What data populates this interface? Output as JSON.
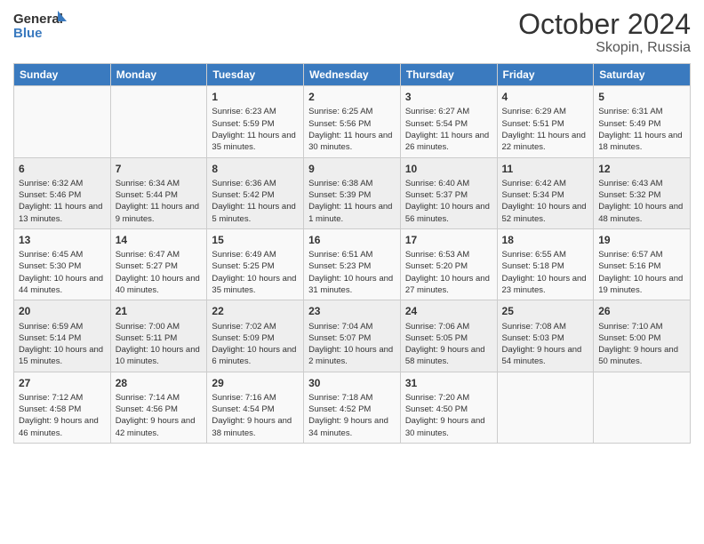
{
  "header": {
    "logo_line1": "General",
    "logo_line2": "Blue",
    "title": "October 2024",
    "subtitle": "Skopin, Russia"
  },
  "days_of_week": [
    "Sunday",
    "Monday",
    "Tuesday",
    "Wednesday",
    "Thursday",
    "Friday",
    "Saturday"
  ],
  "weeks": [
    [
      {
        "day": "",
        "info": ""
      },
      {
        "day": "",
        "info": ""
      },
      {
        "day": "1",
        "info": "Sunrise: 6:23 AM\nSunset: 5:59 PM\nDaylight: 11 hours and 35 minutes."
      },
      {
        "day": "2",
        "info": "Sunrise: 6:25 AM\nSunset: 5:56 PM\nDaylight: 11 hours and 30 minutes."
      },
      {
        "day": "3",
        "info": "Sunrise: 6:27 AM\nSunset: 5:54 PM\nDaylight: 11 hours and 26 minutes."
      },
      {
        "day": "4",
        "info": "Sunrise: 6:29 AM\nSunset: 5:51 PM\nDaylight: 11 hours and 22 minutes."
      },
      {
        "day": "5",
        "info": "Sunrise: 6:31 AM\nSunset: 5:49 PM\nDaylight: 11 hours and 18 minutes."
      }
    ],
    [
      {
        "day": "6",
        "info": "Sunrise: 6:32 AM\nSunset: 5:46 PM\nDaylight: 11 hours and 13 minutes."
      },
      {
        "day": "7",
        "info": "Sunrise: 6:34 AM\nSunset: 5:44 PM\nDaylight: 11 hours and 9 minutes."
      },
      {
        "day": "8",
        "info": "Sunrise: 6:36 AM\nSunset: 5:42 PM\nDaylight: 11 hours and 5 minutes."
      },
      {
        "day": "9",
        "info": "Sunrise: 6:38 AM\nSunset: 5:39 PM\nDaylight: 11 hours and 1 minute."
      },
      {
        "day": "10",
        "info": "Sunrise: 6:40 AM\nSunset: 5:37 PM\nDaylight: 10 hours and 56 minutes."
      },
      {
        "day": "11",
        "info": "Sunrise: 6:42 AM\nSunset: 5:34 PM\nDaylight: 10 hours and 52 minutes."
      },
      {
        "day": "12",
        "info": "Sunrise: 6:43 AM\nSunset: 5:32 PM\nDaylight: 10 hours and 48 minutes."
      }
    ],
    [
      {
        "day": "13",
        "info": "Sunrise: 6:45 AM\nSunset: 5:30 PM\nDaylight: 10 hours and 44 minutes."
      },
      {
        "day": "14",
        "info": "Sunrise: 6:47 AM\nSunset: 5:27 PM\nDaylight: 10 hours and 40 minutes."
      },
      {
        "day": "15",
        "info": "Sunrise: 6:49 AM\nSunset: 5:25 PM\nDaylight: 10 hours and 35 minutes."
      },
      {
        "day": "16",
        "info": "Sunrise: 6:51 AM\nSunset: 5:23 PM\nDaylight: 10 hours and 31 minutes."
      },
      {
        "day": "17",
        "info": "Sunrise: 6:53 AM\nSunset: 5:20 PM\nDaylight: 10 hours and 27 minutes."
      },
      {
        "day": "18",
        "info": "Sunrise: 6:55 AM\nSunset: 5:18 PM\nDaylight: 10 hours and 23 minutes."
      },
      {
        "day": "19",
        "info": "Sunrise: 6:57 AM\nSunset: 5:16 PM\nDaylight: 10 hours and 19 minutes."
      }
    ],
    [
      {
        "day": "20",
        "info": "Sunrise: 6:59 AM\nSunset: 5:14 PM\nDaylight: 10 hours and 15 minutes."
      },
      {
        "day": "21",
        "info": "Sunrise: 7:00 AM\nSunset: 5:11 PM\nDaylight: 10 hours and 10 minutes."
      },
      {
        "day": "22",
        "info": "Sunrise: 7:02 AM\nSunset: 5:09 PM\nDaylight: 10 hours and 6 minutes."
      },
      {
        "day": "23",
        "info": "Sunrise: 7:04 AM\nSunset: 5:07 PM\nDaylight: 10 hours and 2 minutes."
      },
      {
        "day": "24",
        "info": "Sunrise: 7:06 AM\nSunset: 5:05 PM\nDaylight: 9 hours and 58 minutes."
      },
      {
        "day": "25",
        "info": "Sunrise: 7:08 AM\nSunset: 5:03 PM\nDaylight: 9 hours and 54 minutes."
      },
      {
        "day": "26",
        "info": "Sunrise: 7:10 AM\nSunset: 5:00 PM\nDaylight: 9 hours and 50 minutes."
      }
    ],
    [
      {
        "day": "27",
        "info": "Sunrise: 7:12 AM\nSunset: 4:58 PM\nDaylight: 9 hours and 46 minutes."
      },
      {
        "day": "28",
        "info": "Sunrise: 7:14 AM\nSunset: 4:56 PM\nDaylight: 9 hours and 42 minutes."
      },
      {
        "day": "29",
        "info": "Sunrise: 7:16 AM\nSunset: 4:54 PM\nDaylight: 9 hours and 38 minutes."
      },
      {
        "day": "30",
        "info": "Sunrise: 7:18 AM\nSunset: 4:52 PM\nDaylight: 9 hours and 34 minutes."
      },
      {
        "day": "31",
        "info": "Sunrise: 7:20 AM\nSunset: 4:50 PM\nDaylight: 9 hours and 30 minutes."
      },
      {
        "day": "",
        "info": ""
      },
      {
        "day": "",
        "info": ""
      }
    ]
  ]
}
